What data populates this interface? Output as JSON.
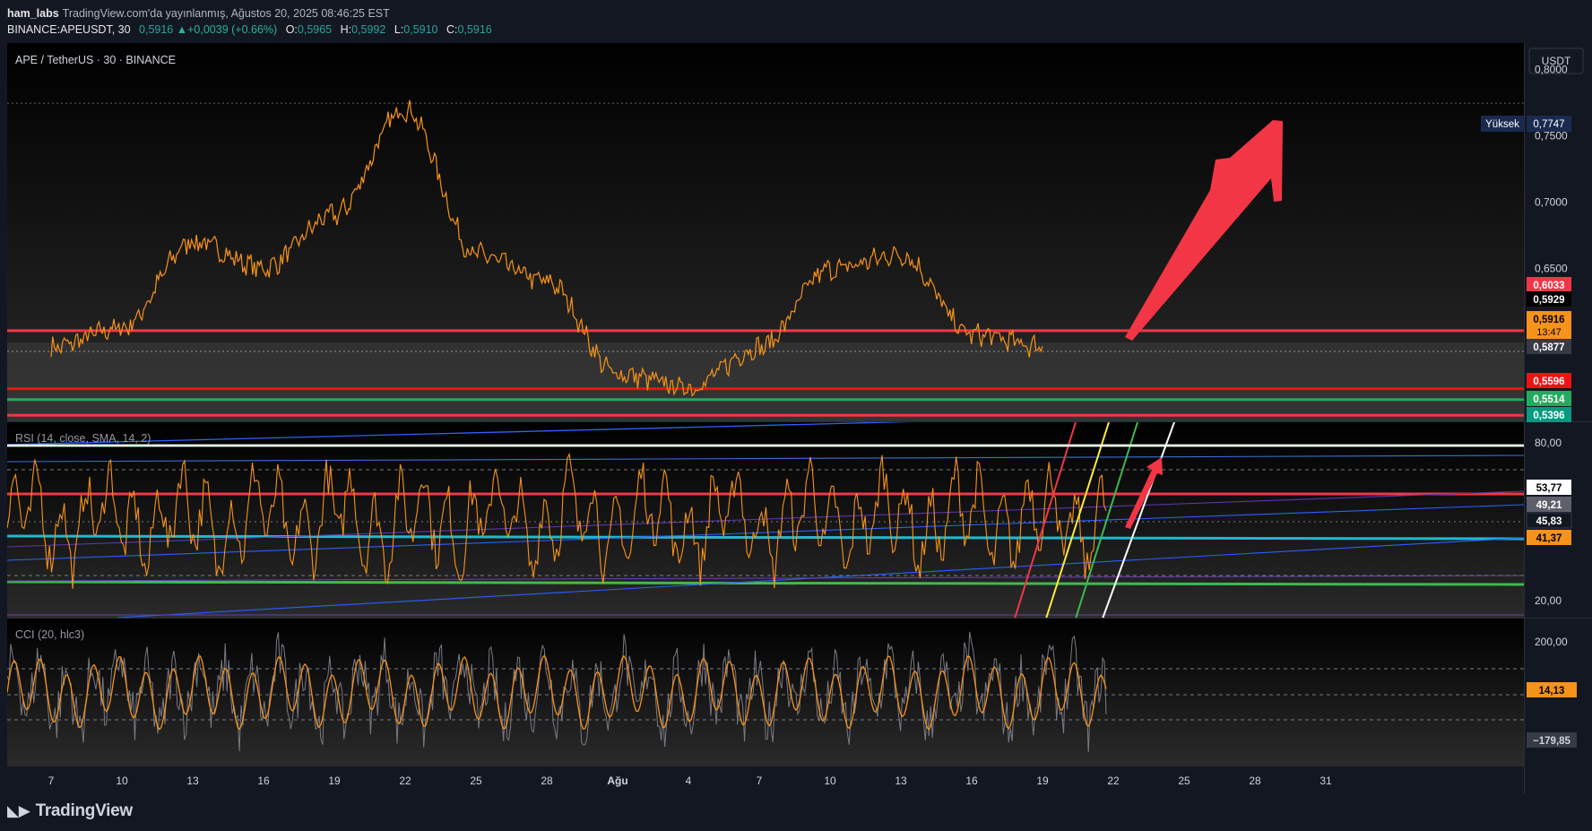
{
  "header": {
    "author": "ham_labs",
    "published": "TradingView.com'da yayınlanmış, Ağustos 20, 2025 08:46:25 EST",
    "symbol": "BINANCE:APEUSDT, 30",
    "last": "0,5916",
    "change_icon": "triangle-up-icon",
    "change": "+0,0039 (+0.66%)",
    "ohlc": [
      {
        "k": "O:",
        "v": "0,5965"
      },
      {
        "k": "H:",
        "v": "0,5992"
      },
      {
        "k": "L:",
        "v": "0,5910"
      },
      {
        "k": "C:",
        "v": "0,5916"
      }
    ]
  },
  "price_pane": {
    "legend": "APE / TetherUS · 30 · BINANCE",
    "currency_button": "USDT",
    "axis_ticks": [
      "0,8000",
      "0,7500",
      "0,7000",
      "0,6500"
    ],
    "high_label": "Yüksek",
    "high_value": "0,7747",
    "price_tags": [
      {
        "text": "0,6033",
        "color": "#f23645"
      },
      {
        "text": "0,5929",
        "color": "#000000"
      },
      {
        "text": "0,5916",
        "sub": "13:47",
        "color": "#f7931a"
      },
      {
        "text": "0,5877",
        "color": "#363a45"
      },
      {
        "text": "0,5596",
        "color": "#f01212"
      },
      {
        "text": "0,5514",
        "color": "#22ab5e"
      },
      {
        "text": "0,5396",
        "color": "#089981"
      }
    ]
  },
  "rsi_pane": {
    "legend": "RSI (14, close, SMA, 14, 2)",
    "axis_ticks": [
      "80,00",
      "20,00"
    ],
    "tags": [
      {
        "text": "53,77",
        "color": "#ffffff",
        "fg": "#000000"
      },
      {
        "text": "49,21",
        "color": "#5d606b",
        "fg": "#ffffff"
      },
      {
        "text": "45,83",
        "color": "#131722",
        "fg": "#ffffff"
      },
      {
        "text": "41,37",
        "color": "#f7931a",
        "fg": "#000000"
      }
    ]
  },
  "cci_pane": {
    "legend": "CCI (20, hlc3)",
    "axis_ticks": [
      "200,00"
    ],
    "tags": [
      {
        "text": "14,13",
        "color": "#f7931a",
        "fg": "#000000"
      },
      {
        "text": "−179,85",
        "color": "#363a45",
        "fg": "#d1d4dc"
      }
    ]
  },
  "time_axis": [
    "7",
    "10",
    "13",
    "16",
    "19",
    "22",
    "25",
    "28",
    "Ağu",
    "4",
    "7",
    "10",
    "13",
    "16",
    "19",
    "22",
    "25",
    "28",
    "31"
  ],
  "footer": {
    "logo_icon": "tradingview-logo-icon",
    "logo_text": "TradingView"
  },
  "chart_data": {
    "type": "line",
    "title": "APE / TetherUS · 30 · BINANCE",
    "xlabel": "",
    "ylabel": "",
    "x": [
      "7",
      "10",
      "13",
      "16",
      "19",
      "22",
      "25",
      "28",
      "Ağu",
      "4",
      "7",
      "10",
      "13",
      "16",
      "19"
    ],
    "ylim": [
      0.535,
      0.82
    ],
    "series": [
      {
        "values": [
          0.5905,
          0.6055,
          0.6705,
          0.6505,
          0.6905,
          0.7705,
          0.6605,
          0.6405,
          0.5705,
          0.5605,
          0.5905,
          0.6495,
          0.6605,
          0.6005,
          0.5916
        ]
      }
    ],
    "horizontal_levels": [
      {
        "value": 0.7747,
        "color": "#5d606b"
      },
      {
        "value": 0.6033,
        "color": "#f23645"
      },
      {
        "value": 0.5877,
        "color": "#9598a1"
      },
      {
        "value": 0.5596,
        "color": "#f01212"
      },
      {
        "value": 0.5514,
        "color": "#22ab5e"
      },
      {
        "value": 0.5396,
        "color": "#f23645"
      }
    ],
    "rsi": {
      "ylim": [
        10,
        90
      ],
      "levels": [
        80,
        50,
        45.83,
        20
      ],
      "last": 53.77,
      "sma": 49.21,
      "band_low": 41.37
    },
    "cci": {
      "ylim": [
        -300,
        300
      ],
      "last": 14.13,
      "low_tag": -179.85
    }
  }
}
